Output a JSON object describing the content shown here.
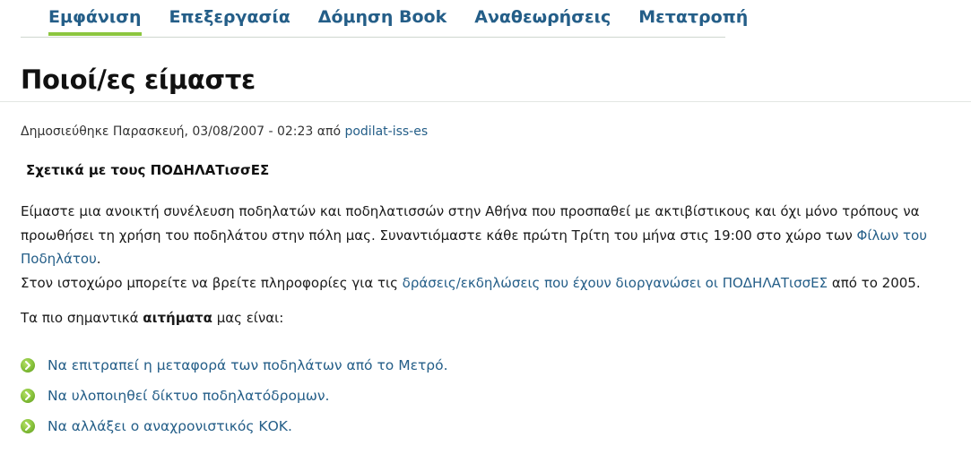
{
  "tabs": [
    {
      "label": "Εμφάνιση",
      "active": true
    },
    {
      "label": "Επεξεργασία",
      "active": false
    },
    {
      "label": "Δόμηση Book",
      "active": false
    },
    {
      "label": "Αναθεωρήσεις",
      "active": false
    },
    {
      "label": "Μετατροπή",
      "active": false
    }
  ],
  "page": {
    "title": "Ποιοί/ες είμαστε"
  },
  "meta": {
    "published_prefix": "Δημοσιεύθηκε Παρασκευή, 03/08/2007 - 02:23 από ",
    "author": "podilat-iss-es"
  },
  "content": {
    "heading": "Σχετικά με τους ΠΟΔΗΛΑΤισσΕΣ",
    "para_text_1": "Είμαστε μια ανοικτή συνέλευση ποδηλατών και ποδηλατισσών στην Αθήνα που προσπαθεί με ακτιβίστικους και όχι μόνο τρόπους να προωθήσει τη χρήση του ποδηλάτου στην πόλη μας. Συναντιόμαστε κάθε πρώτη Τρίτη του μήνα στις 19:00 στο χώρο των ",
    "friends_link": "Φίλων του Ποδηλάτου",
    "para_text_2": ".",
    "para_text_3": "Στον ιστοχώρο μπορείτε να βρείτε πληροφορίες για τις ",
    "actions_link": "δράσεις/εκδηλώσεις που έχουν διοργανώσει οι ΠΟΔΗΛΑΤισσΕΣ",
    "para_text_4": " από το 2005.",
    "demands_prefix": "Τα πιο σημαντικά ",
    "demands_bold": "αιτήματα",
    "demands_suffix": " μας είναι:",
    "demands": [
      "Να επιτραπεί η μεταφορά των ποδηλάτων από το Μετρό.",
      "Να υλοποιηθεί δίκτυο ποδηλατόδρομων.",
      "Να αλλάξει ο αναχρονιστικός ΚΟΚ."
    ]
  },
  "colors": {
    "link": "#245e88",
    "accent": "#8cc63f"
  },
  "icons": {
    "list_bullet": "green-circle-chevron-icon"
  }
}
